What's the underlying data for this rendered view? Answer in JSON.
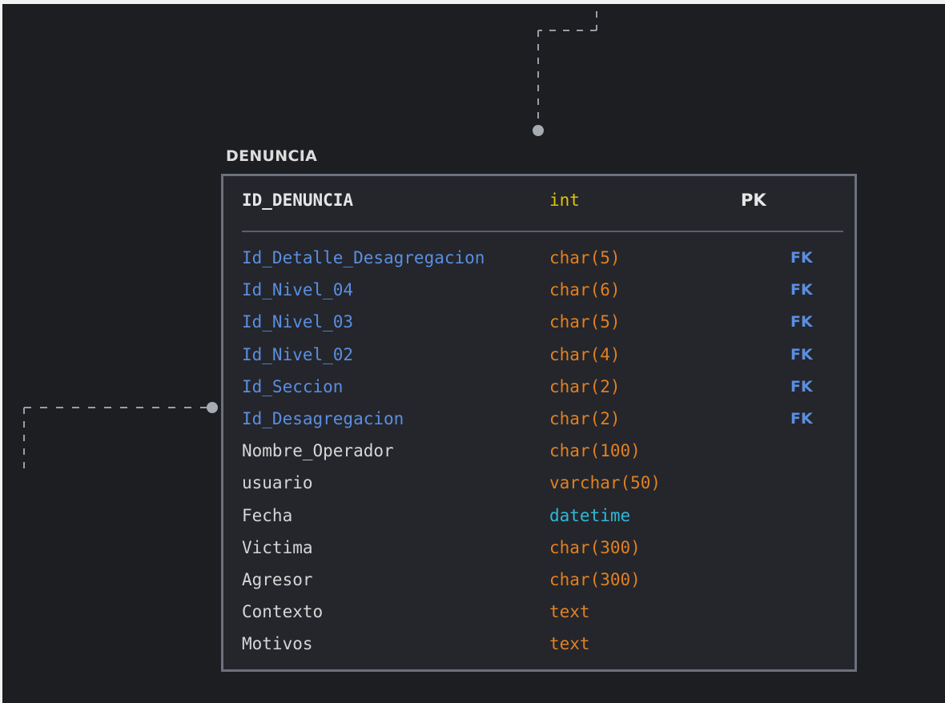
{
  "colors": {
    "background": "#1d1e22",
    "table_border": "#6c717c",
    "fk_text": "#5b8ee0",
    "type_orange": "#e3801f",
    "type_int": "#e2c400",
    "type_datetime": "#2fb8d8"
  },
  "table": {
    "name": "DENUNCIA",
    "primary_key": {
      "name": "ID_DENUNCIA",
      "type": "int",
      "key": "PK"
    },
    "columns": [
      {
        "name": "Id_Detalle_Desagregacion",
        "type": "char(5)",
        "key": "FK",
        "type_color": "#e3801f"
      },
      {
        "name": "Id_Nivel_04",
        "type": "char(6)",
        "key": "FK",
        "type_color": "#e3801f"
      },
      {
        "name": "Id_Nivel_03",
        "type": "char(5)",
        "key": "FK",
        "type_color": "#e3801f"
      },
      {
        "name": "Id_Nivel_02",
        "type": "char(4)",
        "key": "FK",
        "type_color": "#e3801f"
      },
      {
        "name": "Id_Seccion",
        "type": "char(2)",
        "key": "FK",
        "type_color": "#e3801f"
      },
      {
        "name": "Id_Desagregacion",
        "type": "char(2)",
        "key": "FK",
        "type_color": "#e3801f"
      },
      {
        "name": "Nombre_Operador",
        "type": "char(100)",
        "key": "",
        "type_color": "#e3801f"
      },
      {
        "name": "usuario",
        "type": "varchar(50)",
        "key": "",
        "type_color": "#e3801f"
      },
      {
        "name": "Fecha",
        "type": "datetime",
        "key": "",
        "type_color": "#2fb8d8"
      },
      {
        "name": "Victima",
        "type": "char(300)",
        "key": "",
        "type_color": "#e3801f"
      },
      {
        "name": "Agresor",
        "type": "char(300)",
        "key": "",
        "type_color": "#e3801f"
      },
      {
        "name": "Contexto",
        "type": "text",
        "key": "",
        "type_color": "#e3801f"
      },
      {
        "name": "Motivos",
        "type": "text",
        "key": "",
        "type_color": "#e3801f"
      }
    ]
  }
}
